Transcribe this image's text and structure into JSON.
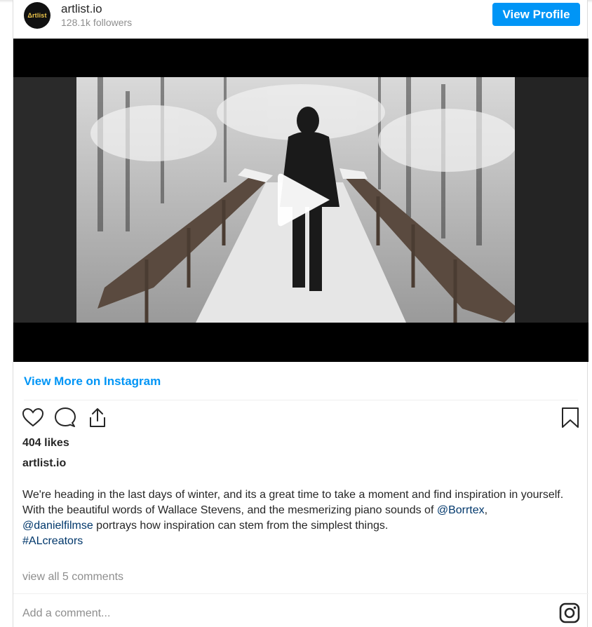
{
  "profile": {
    "avatar_text": "Δrtlist",
    "username": "artlist.io",
    "followers": "128.1k followers",
    "view_profile_label": "View Profile"
  },
  "media": {
    "description": "video"
  },
  "links": {
    "view_more": "View More on Instagram"
  },
  "actions": {
    "like_icon": "heart-icon",
    "comment_icon": "comment-icon",
    "share_icon": "share-icon",
    "save_icon": "bookmark-icon"
  },
  "post": {
    "likes": "404 likes",
    "username": "artlist.io",
    "caption_line1": "We're heading in the last days of winter, and its a great time to take a moment and find inspiration in yourself.",
    "caption_line2_prefix": "With the beautiful words of Wallace Stevens, and the mesmerizing piano sounds of ",
    "mention1": "@Borrtex",
    "comma": ",",
    "mention2": "@danielfilmse",
    "caption_line3_suffix": " portrays how inspiration can stem from the simplest things.",
    "hashtag": "#ALcreators",
    "view_comments": "view all 5 comments",
    "add_comment_placeholder": "Add a comment..."
  },
  "colors": {
    "accent": "#0095f6",
    "text": "#262626",
    "muted": "#8e8e8e",
    "tag": "#00376b"
  }
}
